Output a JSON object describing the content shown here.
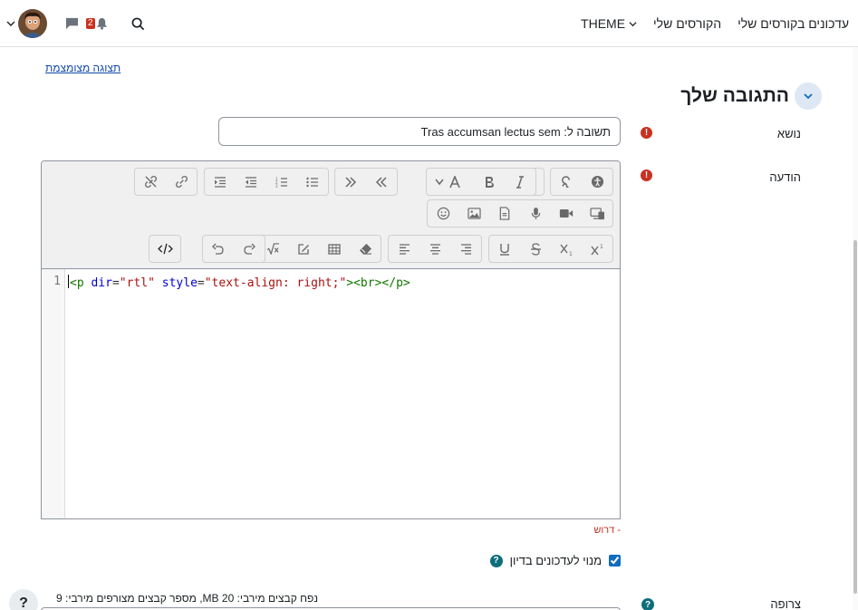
{
  "navbar": {
    "links": [
      "עדכונים בקורסים שלי",
      "הקורסים שלי"
    ],
    "theme_label": "THEME",
    "notification_count": "2"
  },
  "compact_view_link": "תצוגה מצומצמת",
  "section": {
    "title": "התגובה שלך"
  },
  "subject": {
    "label": "נושא",
    "value": "תשובה ל: Tras accumsan lectus sem"
  },
  "message": {
    "label": "הודעה",
    "line_number": "1",
    "code": {
      "tag_open": "<p",
      "attr1": " dir",
      "eq1": "=",
      "val1": "\"rtl\"",
      "attr2": " style",
      "eq2": "=",
      "val2": "\"text-align: right;\"",
      "tag_rest": "><br></p>"
    }
  },
  "required_note": "- דרוש",
  "subscribe": {
    "label": "מנוי לעדכונים בדיון",
    "checked": true
  },
  "attachment": {
    "label": "צרופה",
    "limits": "נפח קבצים מירבי: 20 MB, מספר קבצים מצורפים מירבי: 9"
  },
  "help_button": "?",
  "colors": {
    "accent": "#0f6cbf",
    "danger": "#ca3120",
    "help": "#0f6e7a"
  }
}
